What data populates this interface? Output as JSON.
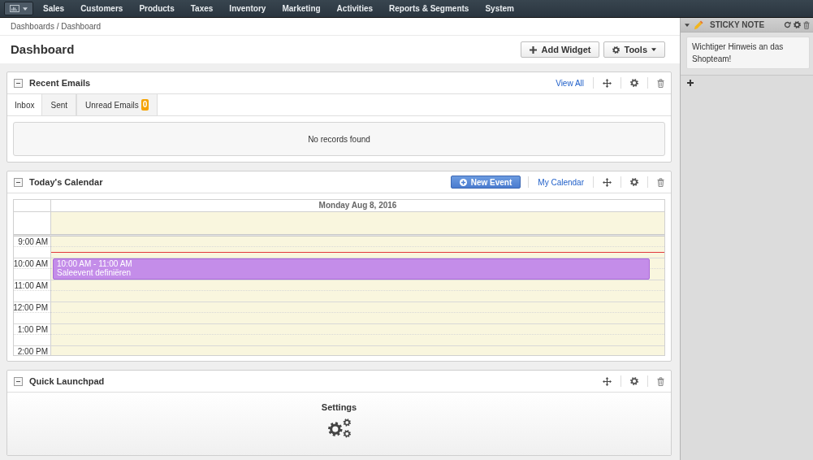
{
  "nav": {
    "items": [
      "Sales",
      "Customers",
      "Products",
      "Taxes",
      "Inventory",
      "Marketing",
      "Activities",
      "Reports & Segments",
      "System"
    ]
  },
  "breadcrumb": "Dashboards / Dashboard",
  "page": {
    "title": "Dashboard",
    "actions": [
      {
        "kind": "add",
        "label": "Add Widget"
      },
      {
        "kind": "menu",
        "label": "Tools"
      }
    ]
  },
  "widgets": [
    {
      "kind": "emails",
      "title": "Recent Emails",
      "expanded": true,
      "header_links": [
        {
          "kind": "link",
          "label": "View All"
        }
      ],
      "tabs": [
        {
          "label": "Inbox",
          "selected": true
        },
        {
          "label": "Sent",
          "selected": false
        },
        {
          "label": "Unread Emails",
          "selected": false,
          "badge": "0"
        }
      ],
      "empty_text": "No records found"
    },
    {
      "kind": "calendar",
      "title": "Today's Calendar",
      "expanded": true,
      "header_links": [
        {
          "kind": "button",
          "label": "New Event"
        },
        {
          "kind": "link",
          "label": "My Calendar"
        }
      ],
      "calendar": {
        "day_heading": "Monday Aug 8, 2016",
        "hours": [
          {
            "label": "9:00 AM",
            "current": true
          },
          {
            "label": "10:00 AM",
            "current": false,
            "events": [
              {
                "time": "10:00 AM - 11:00 AM",
                "title": "Saleevent definiëren",
                "color": "#c48de9"
              }
            ]
          },
          {
            "label": "11:00 AM",
            "current": false
          },
          {
            "label": "12:00 PM",
            "current": false
          },
          {
            "label": "1:00 PM",
            "current": false
          },
          {
            "label": "2:00 PM",
            "current": false
          }
        ]
      }
    },
    {
      "kind": "launchpad",
      "title": "Quick Launchpad",
      "expanded": true,
      "items": [
        {
          "label": "Settings"
        }
      ]
    }
  ],
  "sidebar": {
    "widgets": [
      {
        "kind": "sticky_note",
        "title": "STICKY NOTE",
        "expanded": true,
        "text": "Wichtiger Hinweis an das Shopteam!"
      }
    ]
  }
}
